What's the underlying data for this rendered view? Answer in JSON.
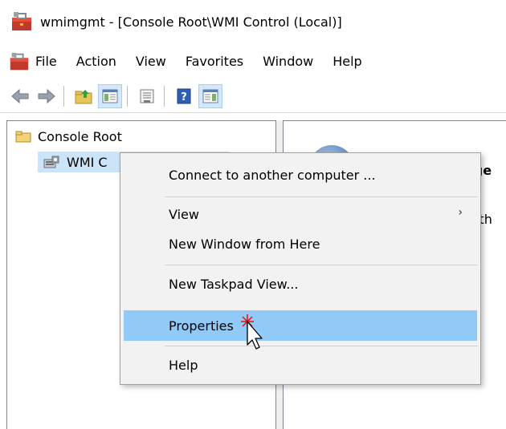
{
  "window": {
    "title": "wmimgmt - [Console Root\\WMI Control (Local)]",
    "app_icon": "toolbox-icon"
  },
  "menubar": {
    "items": [
      "File",
      "Action",
      "View",
      "Favorites",
      "Window",
      "Help"
    ]
  },
  "toolbar": {
    "buttons": [
      "back-arrow-icon",
      "forward-arrow-icon",
      "up-folder-icon",
      "show-hide-tree-icon",
      "properties-icon",
      "help-icon",
      "show-hide-action-pane-icon"
    ]
  },
  "tree": {
    "root_label": "Console Root",
    "child_label": "WMI C"
  },
  "result_pane": {
    "peek_line1": "age",
    "peek_line2": "s th"
  },
  "context_menu": {
    "items": [
      {
        "label": "Connect to another computer ...",
        "submenu": false
      },
      {
        "label": "View",
        "submenu": true
      },
      {
        "label": "New Window from Here",
        "submenu": false
      },
      {
        "label": "New Taskpad View...",
        "submenu": false
      },
      {
        "label": "Properties",
        "submenu": false,
        "highlighted": true
      },
      {
        "label": "Help",
        "submenu": false
      }
    ],
    "submenu_arrow": "›"
  },
  "colors": {
    "highlight": "#91c9f7",
    "selection": "#cce4f7",
    "menu_bg": "#f2f2f2"
  }
}
